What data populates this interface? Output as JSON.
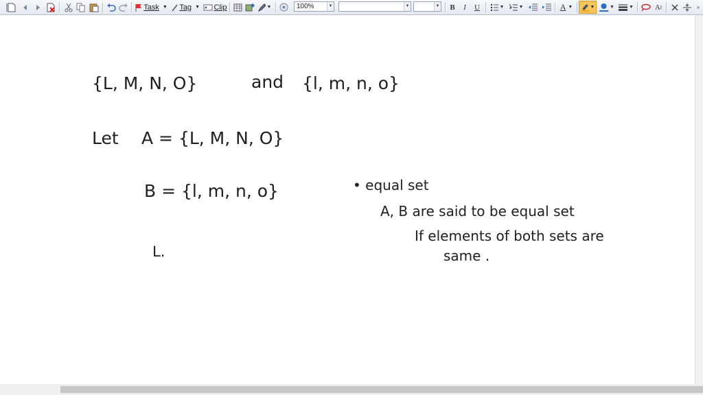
{
  "toolbar": {
    "task_label": "Task",
    "tag_label": "Tag",
    "clip_label": "Clip",
    "zoom_value": "100%",
    "font_family_value": "",
    "font_size_value": "",
    "bold_label": "B",
    "italic_label": "I",
    "underline_label": "U",
    "font_color_label": "A",
    "clear_format_label": "A",
    "colors": {
      "highlight": "#f5a623",
      "font_color": "#2c6fc1",
      "accent": "#1f6fd1"
    }
  },
  "canvas": {
    "line1_left": "{L, M, N, O}",
    "line1_and": "and",
    "line1_right": "{l, m, n, o}",
    "let_word": "Let",
    "set_a": "A = {L, M, N, O}",
    "set_b": "B = {l, m, n, o}",
    "bullet_title": "• equal set",
    "def_line1": "A, B are said to be equal set",
    "def_line2": "If elements of both sets are",
    "def_line3": "same .",
    "stray_mark": "L."
  }
}
